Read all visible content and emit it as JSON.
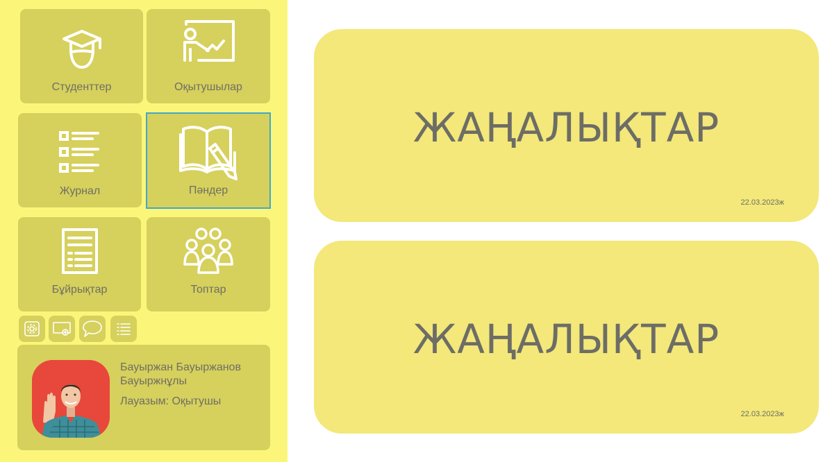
{
  "sidebar": {
    "tiles": [
      {
        "label": "Студенттер",
        "icon": "graduate-icon"
      },
      {
        "label": "Оқытушылар",
        "icon": "teacher-board-icon"
      },
      {
        "label": "Журнал",
        "icon": "list-icon"
      },
      {
        "label": "Пәндер",
        "icon": "book-pencil-icon"
      },
      {
        "label": "Бұйрықтар",
        "icon": "document-icon"
      },
      {
        "label": "Топтар",
        "icon": "group-icon"
      }
    ],
    "toolbar": [
      {
        "icon": "settings-icon"
      },
      {
        "icon": "add-screen-icon"
      },
      {
        "icon": "chat-icon"
      },
      {
        "icon": "menu-list-icon"
      }
    ]
  },
  "profile": {
    "name": "Бауыржан Бауыржанов Бауыржнұлы",
    "role": "Лауазым: Оқытушы",
    "avatar_bg": "#e8473b"
  },
  "news": [
    {
      "title": "ЖАҢАЛЫҚТАР",
      "date": "22.03.2023ж"
    },
    {
      "title": "ЖАҢАЛЫҚТАР",
      "date": "22.03.2023ж"
    }
  ],
  "colors": {
    "sidebar_bg": "#fbf67a",
    "tile_bg": "#d6d05d",
    "card_bg": "#f3e879",
    "active_border": "#3fa9c9"
  }
}
